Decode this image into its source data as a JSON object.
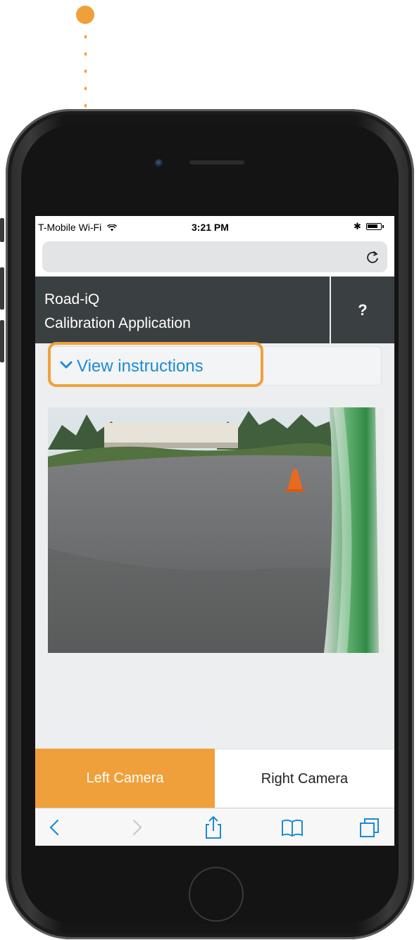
{
  "status_bar": {
    "carrier": "T-Mobile Wi-Fi",
    "time": "3:21 PM",
    "wifi_icon": "wifi-icon",
    "bluetooth_icon": "bluetooth-icon",
    "battery_icon": "battery-icon"
  },
  "browser": {
    "url_text": "",
    "reload_icon": "reload-icon"
  },
  "app": {
    "title_line1": "Road-iQ",
    "title_line2": "Calibration Application",
    "help_label": "?"
  },
  "instructions": {
    "label": "View instructions",
    "icon": "chevron-down-icon"
  },
  "camera_tabs": {
    "left_label": "Left Camera",
    "right_label": "Right Camera",
    "selected": "Left Camera"
  },
  "toolbar": {
    "items": [
      "back-icon",
      "forward-icon",
      "share-icon",
      "bookmarks-icon",
      "tabs-icon"
    ]
  },
  "colors": {
    "accent": "#f0a03a",
    "header_bg": "#3a3f41",
    "link_blue": "#1d8bd1"
  }
}
